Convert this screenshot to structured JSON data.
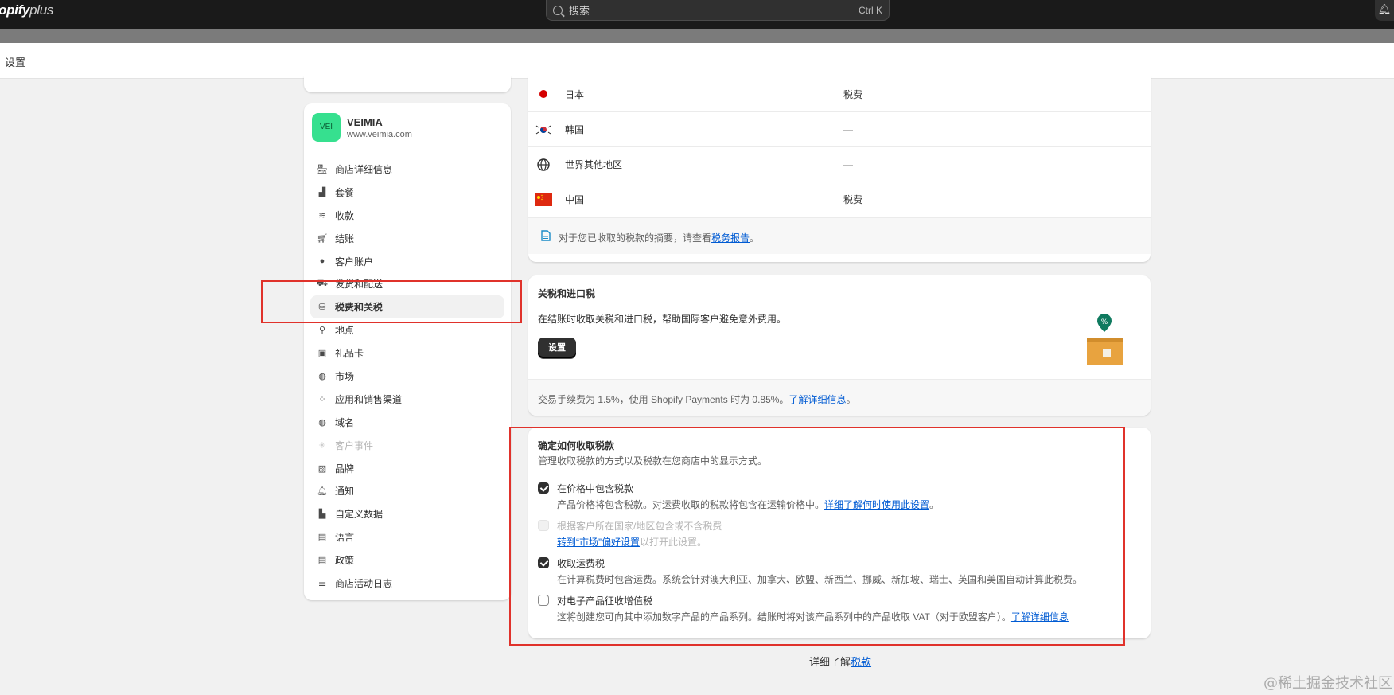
{
  "topbar": {
    "logo_main": "opify",
    "logo_prefix": "h",
    "logo_plus": "plus",
    "search_placeholder": "搜索",
    "search_shortcut": "Ctrl K"
  },
  "page": {
    "title": "设置"
  },
  "store": {
    "avatar_text": "VEI",
    "name": "VEIMIA",
    "url": "www.veimia.com"
  },
  "nav": [
    {
      "label": "商店详细信息",
      "icon": "store-icon"
    },
    {
      "label": "套餐",
      "icon": "plan-icon"
    },
    {
      "label": "收款",
      "icon": "payments-icon"
    },
    {
      "label": "结账",
      "icon": "cart-icon"
    },
    {
      "label": "客户账户",
      "icon": "person-icon"
    },
    {
      "label": "发货和配送",
      "icon": "truck-icon"
    },
    {
      "label": "税费和关税",
      "icon": "tax-bag-icon",
      "active": true
    },
    {
      "label": "地点",
      "icon": "location-icon"
    },
    {
      "label": "礼品卡",
      "icon": "gift-card-icon"
    },
    {
      "label": "市场",
      "icon": "globe-market-icon"
    },
    {
      "label": "应用和销售渠道",
      "icon": "apps-icon"
    },
    {
      "label": "域名",
      "icon": "domain-globe-icon"
    },
    {
      "label": "客户事件",
      "icon": "events-icon",
      "disabled": true
    },
    {
      "label": "品牌",
      "icon": "brand-icon"
    },
    {
      "label": "通知",
      "icon": "bell-icon"
    },
    {
      "label": "自定义数据",
      "icon": "data-icon"
    },
    {
      "label": "语言",
      "icon": "language-icon"
    },
    {
      "label": "政策",
      "icon": "policy-icon"
    },
    {
      "label": "商店活动日志",
      "icon": "list-icon"
    }
  ],
  "regions": {
    "rows": [
      {
        "name": "日本",
        "value": "税费",
        "flag": "japan-flag-icon"
      },
      {
        "name": "韩国",
        "value": "—",
        "flag": "korea-flag-icon"
      },
      {
        "name": "世界其他地区",
        "value": "—",
        "flag": "globe-icon"
      },
      {
        "name": "中国",
        "value": "税费",
        "flag": "china-flag-icon"
      }
    ],
    "footer_text": "对于您已收取的税款的摘要，请查看",
    "footer_link": "税务报告",
    "footer_end": "。"
  },
  "duties": {
    "title": "关税和进口税",
    "description": "在结账时收取关税和进口税，帮助国际客户避免意外费用。",
    "button": "设置",
    "footer_text": "交易手续费为 1.5%，使用 Shopify Payments 时为 0.85%。",
    "footer_link": "了解详细信息",
    "footer_end": "。"
  },
  "collect": {
    "title": "确定如何收取税款",
    "subtitle": "管理收取税款的方式以及税款在您商店中的显示方式。",
    "options": [
      {
        "label": "在价格中包含税款",
        "hint": "产品价格将包含税款。对运费收取的税款将包含在运输价格中。",
        "link": "详细了解何时使用此设置",
        "end": "。",
        "checked": true
      },
      {
        "label": "根据客户所在国家/地区包含或不含税费",
        "hint_link": "转到“市场”偏好设置",
        "hint": "以打开此设置。",
        "checked": false,
        "disabled": true
      },
      {
        "label": "收取运费税",
        "hint": "在计算税费时包含运费。系统会针对澳大利亚、加拿大、欧盟、新西兰、挪威、新加坡、瑞士、英国和美国自动计算此税费。",
        "checked": true
      },
      {
        "label": "对电子产品征收增值税",
        "hint": "这将创建您可向其中添加数字产品的产品系列。结账时将对该产品系列中的产品收取 VAT（对于欧盟客户）。",
        "link": "了解详细信息",
        "checked": false
      }
    ]
  },
  "learn_more": {
    "text": "详细了解",
    "link": "税款"
  },
  "watermark": "@稀土掘金技术社区",
  "colors": {
    "accent": "#005bd3",
    "highlight": "#e0322b",
    "topbar": "#1a1a1a"
  }
}
